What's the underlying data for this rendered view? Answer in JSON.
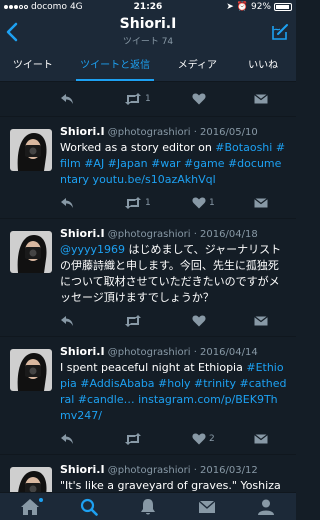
{
  "status_bar": {
    "carrier": "docomo",
    "network": "4G",
    "time": "21:26",
    "battery": "92%",
    "battery_level": 0.92
  },
  "header": {
    "title": "Shiori.I",
    "subtitle": "ツイート 74"
  },
  "tabs": [
    {
      "label": "ツイート",
      "active": false
    },
    {
      "label": "ツイートと返信",
      "active": true
    },
    {
      "label": "メディア",
      "active": false
    },
    {
      "label": "いいね",
      "active": false
    }
  ],
  "top_actions": {
    "retweets": "1",
    "likes": ""
  },
  "tweets": [
    {
      "name": "Shiori.I",
      "handle": "@photograshiori",
      "date": "· 2016/05/10",
      "text_plain": "Worked as a story editor on ",
      "text_link": "#Botaoshi #film #AJ #Japan #war #game #documentary youtu.be/s10azAkhVql",
      "retweets": "1",
      "likes": "1"
    },
    {
      "name": "Shiori.I",
      "handle": "@photograshiori",
      "date": "· 2016/04/18",
      "text_mention": "@yyyy1969",
      "text_plain": " はじめまして、ジャーナリストの伊藤詩織と申します。今回、先生に孤独死について取材させていただきたいのですがメッセージ頂けますでしょうか？",
      "retweets": "",
      "likes": ""
    },
    {
      "name": "Shiori.I",
      "handle": "@photograshiori",
      "date": "· 2016/04/14",
      "text_plain": "I spent peaceful night at Ethiopia ",
      "text_link": "#Ethiopia #AddisAbaba #holy #trinity #cathedral #candle… instagram.com/p/BEK9Thmv247/",
      "retweets": "",
      "likes": "2"
    },
    {
      "name": "Shiori.I",
      "handle": "@photograshiori",
      "date": "· 2016/03/12",
      "text_plain": "\"It's like a graveyard of graves.\" Yoshizawa said."
    }
  ],
  "icons": {
    "back": "chevron-left-icon",
    "compose": "compose-icon",
    "reply": "reply-icon",
    "retweet": "retweet-icon",
    "like": "heart-icon",
    "dm": "envelope-icon",
    "home": "home-icon",
    "search": "search-icon",
    "notifications": "bell-icon",
    "messages": "mail-icon",
    "me": "person-icon"
  },
  "colors": {
    "background": "#141d26",
    "bar": "#1c2938",
    "accent": "#1da1f2",
    "muted": "#8899a6"
  }
}
